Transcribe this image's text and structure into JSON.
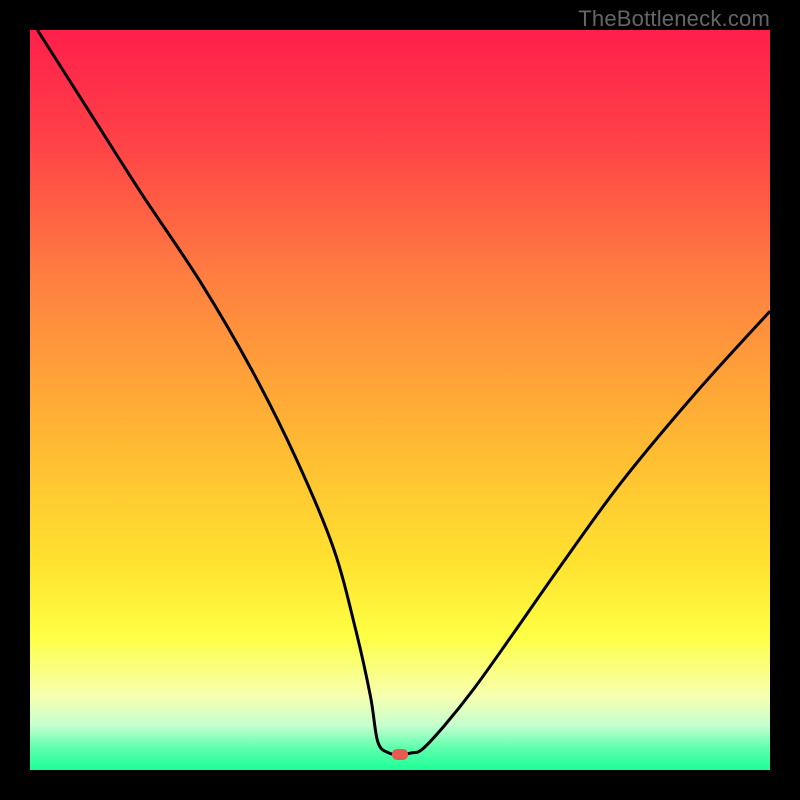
{
  "watermark": "TheBottleneck.com",
  "chart_data": {
    "type": "line",
    "title": "",
    "xlabel": "",
    "ylabel": "",
    "xlim": [
      0,
      100
    ],
    "ylim": [
      0,
      100
    ],
    "grid": false,
    "legend": false,
    "series": [
      {
        "name": "curve",
        "x": [
          1,
          8,
          15,
          23,
          30,
          36,
          41,
          44,
          46,
          47,
          48.5,
          50,
          51.5,
          53,
          56,
          60,
          65,
          72,
          80,
          90,
          100
        ],
        "y": [
          100,
          89,
          78,
          66,
          54,
          42,
          30,
          19,
          10,
          3.8,
          2.3,
          2.1,
          2.3,
          2.8,
          6,
          11,
          18,
          28,
          39,
          51,
          62
        ]
      }
    ],
    "marker": {
      "x": 50,
      "y": 2.1,
      "color": "#e85a4f",
      "shape": "rounded-rect"
    },
    "background_gradient": {
      "stops": [
        {
          "offset": 0.0,
          "color": "#ff1f4b"
        },
        {
          "offset": 0.15,
          "color": "#ff4147"
        },
        {
          "offset": 0.35,
          "color": "#ff8340"
        },
        {
          "offset": 0.55,
          "color": "#ffb733"
        },
        {
          "offset": 0.72,
          "color": "#ffe22f"
        },
        {
          "offset": 0.82,
          "color": "#feff44"
        },
        {
          "offset": 0.9,
          "color": "#f7ffb0"
        },
        {
          "offset": 0.94,
          "color": "#c5ffcf"
        },
        {
          "offset": 0.97,
          "color": "#5fffad"
        },
        {
          "offset": 1.0,
          "color": "#1cff96"
        }
      ]
    }
  }
}
